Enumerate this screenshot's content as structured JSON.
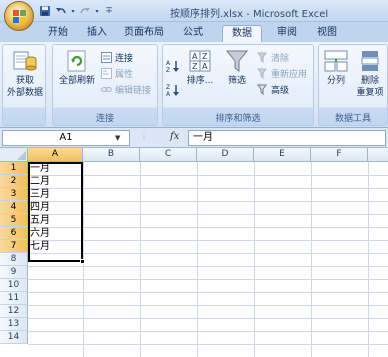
{
  "title": {
    "text": "按顺序排列.xlsx - Microsoft Excel",
    "qat_icons": [
      "save-icon",
      "undo-icon",
      "redo-icon",
      "customize-icon"
    ]
  },
  "tabs": [
    {
      "label": "开始",
      "active": false
    },
    {
      "label": "插入",
      "active": false
    },
    {
      "label": "页面布局",
      "active": false
    },
    {
      "label": "公式",
      "active": false
    },
    {
      "label": "数据",
      "active": true
    },
    {
      "label": "审阅",
      "active": false
    },
    {
      "label": "视图",
      "active": false
    }
  ],
  "ribbon": {
    "get_external": {
      "line1": "获取",
      "line2": "外部数据"
    },
    "connections": {
      "refresh_all": "全部刷新",
      "connections": "连接",
      "properties": "属性",
      "edit_links": "编辑链接",
      "group_label": "连接"
    },
    "sort_filter": {
      "sort": "排序...",
      "filter": "筛选",
      "clear": "清除",
      "reapply": "重新应用",
      "advanced": "高级",
      "group_label": "排序和筛选"
    },
    "data_tools": {
      "text_to_columns": "分列",
      "remove_duplicates_line1": "删除",
      "remove_duplicates_line2": "重复项",
      "group_label": "数据工具"
    }
  },
  "formula_bar": {
    "name_box": "A1",
    "fx": "fx",
    "value": "一月"
  },
  "sheet": {
    "columns": [
      "A",
      "B",
      "C",
      "D",
      "E",
      "F"
    ],
    "rows": [
      "1",
      "2",
      "3",
      "4",
      "5",
      "6",
      "7",
      "8",
      "9",
      "10",
      "11",
      "12",
      "13",
      "14"
    ],
    "col_a_values": [
      "一月",
      "二月",
      "三月",
      "四月",
      "五月",
      "六月",
      "七月"
    ]
  },
  "colors": {
    "selected_header": "#f1c15f",
    "active_tab": "#f0f6fd"
  }
}
